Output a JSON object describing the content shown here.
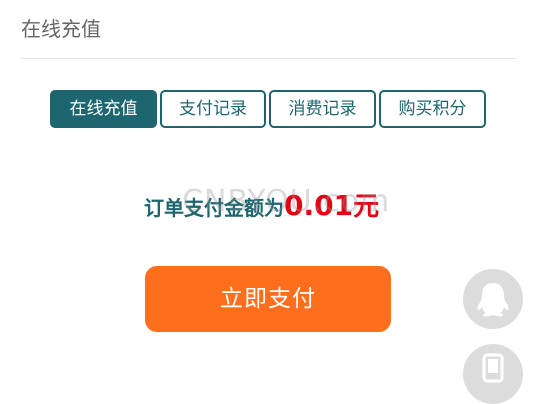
{
  "header": {
    "title": "在线充值"
  },
  "tabs": [
    {
      "label": "在线充值",
      "active": true
    },
    {
      "label": "支付记录",
      "active": false
    },
    {
      "label": "消费记录",
      "active": false
    },
    {
      "label": "购买积分",
      "active": false
    }
  ],
  "order": {
    "amount_label": "订单支付金额为",
    "amount_value": "0.01",
    "amount_unit": "元"
  },
  "watermark": "CNBYOU.com",
  "pay_button": {
    "label": "立即支付"
  },
  "float_buttons": [
    {
      "icon": "qq-penguin-icon"
    },
    {
      "icon": "phone-icon"
    }
  ],
  "colors": {
    "accent": "#1d6670",
    "pay_button": "#ff6e1c",
    "amount": "#e60012",
    "float_button_bg": "#dcdcdc"
  }
}
